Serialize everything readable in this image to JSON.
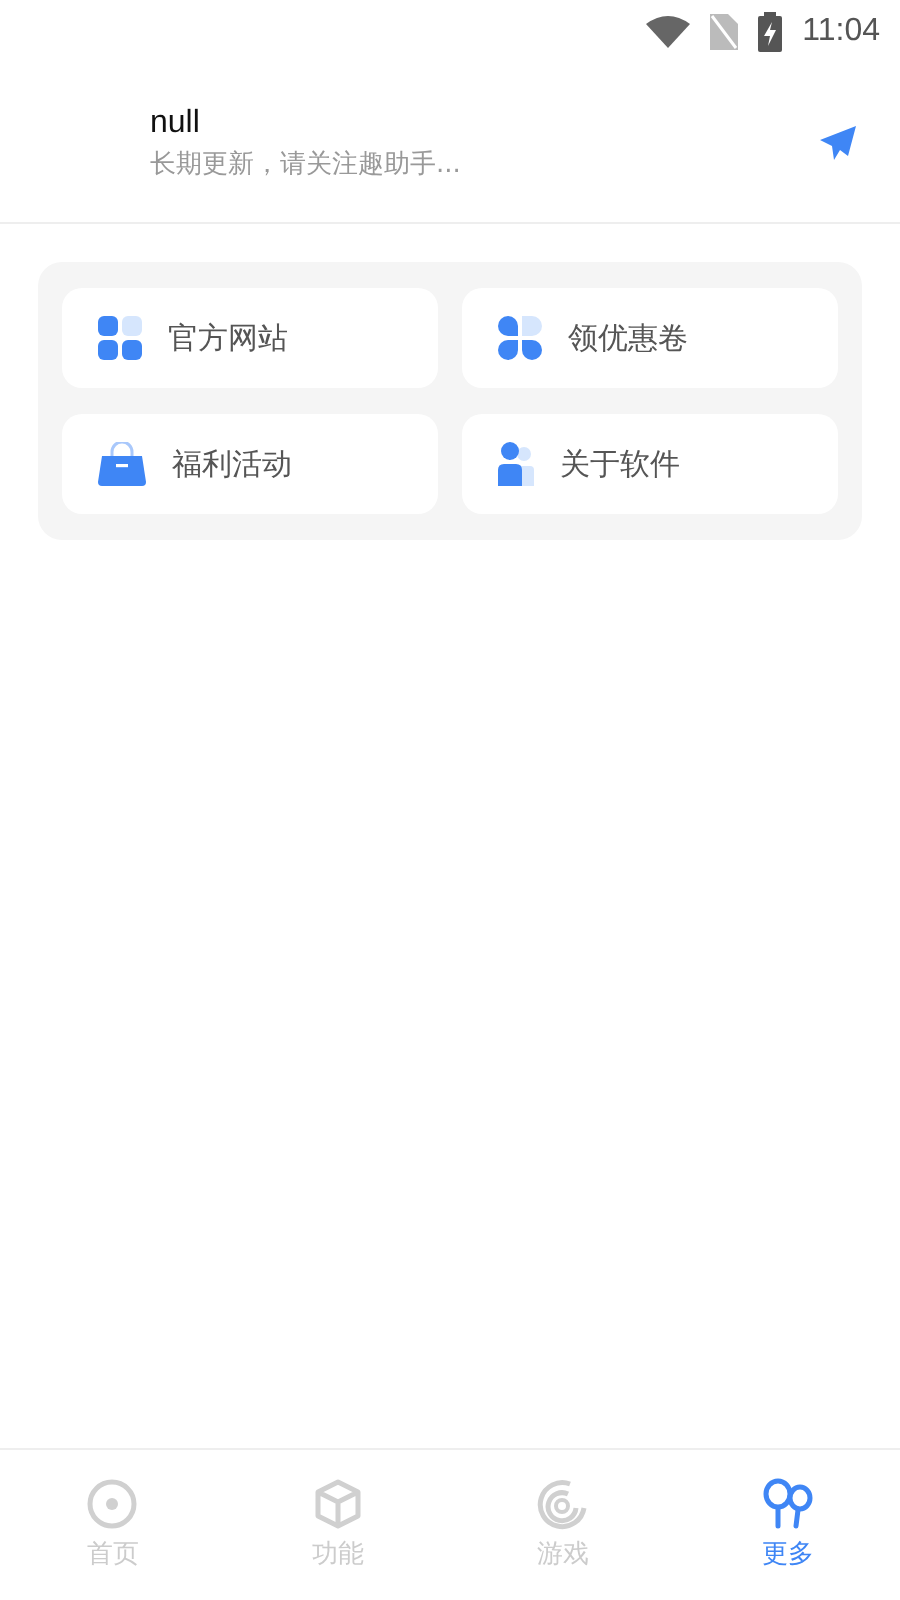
{
  "status_bar": {
    "time": "11:04"
  },
  "header": {
    "title": "null",
    "subtitle": "长期更新，请关注趣助手..."
  },
  "menu": [
    {
      "label": "官方网站",
      "kind": "grid"
    },
    {
      "label": "领优惠卷",
      "kind": "petals"
    },
    {
      "label": "福利活动",
      "kind": "bag"
    },
    {
      "label": "关于软件",
      "kind": "person"
    }
  ],
  "tabs": [
    {
      "label": "首页",
      "kind": "home",
      "selected": false
    },
    {
      "label": "功能",
      "kind": "cube",
      "selected": false
    },
    {
      "label": "游戏",
      "kind": "spiral",
      "selected": false
    },
    {
      "label": "更多",
      "kind": "balloons",
      "selected": true
    }
  ]
}
